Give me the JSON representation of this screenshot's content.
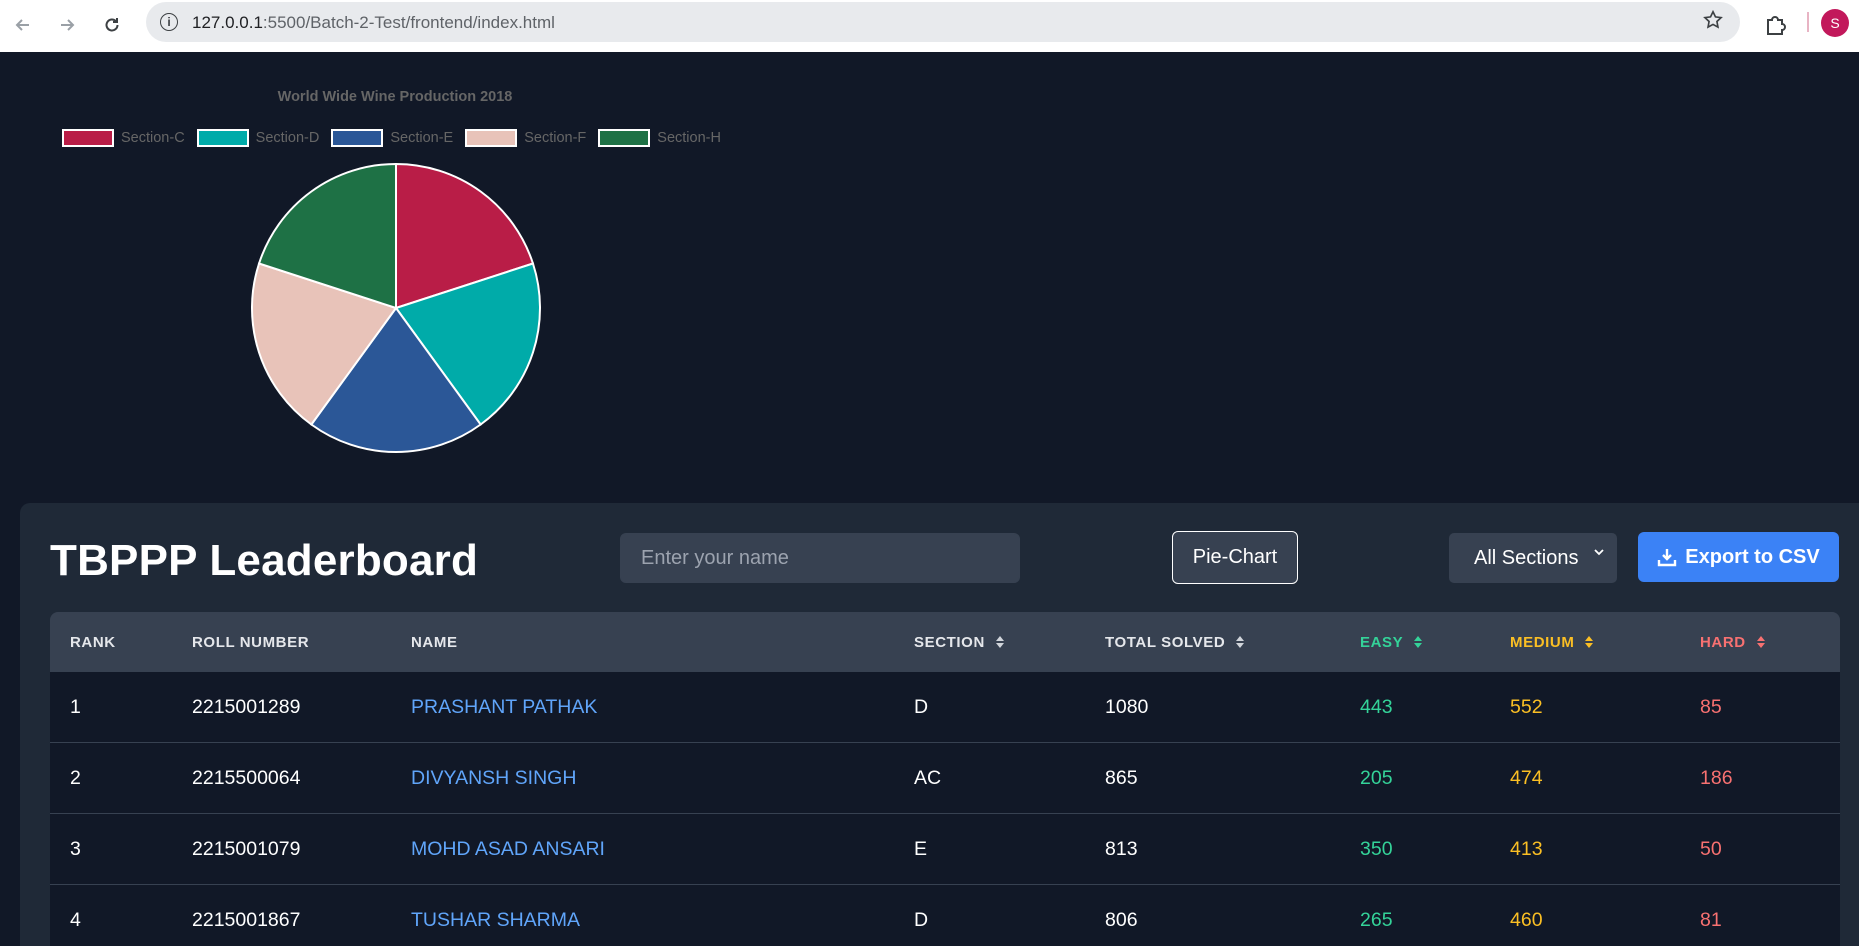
{
  "browser": {
    "url_host": "127.0.0.1",
    "url_path": ":5500/Batch-2-Test/frontend/index.html",
    "profile_initial": "S"
  },
  "chart": {
    "title": "World Wide Wine Production 2018"
  },
  "chart_data": {
    "type": "pie",
    "title": "World Wide Wine Production 2018",
    "categories": [
      "Section-C",
      "Section-D",
      "Section-E",
      "Section-F",
      "Section-H"
    ],
    "values": [
      1,
      1,
      1,
      1,
      1
    ],
    "colors": [
      "#b91d47",
      "#00aba9",
      "#2b5797",
      "#e8c3b9",
      "#1e7145"
    ],
    "legend_position": "top"
  },
  "leaderboard": {
    "title": "TBPPP Leaderboard",
    "search_placeholder": "Enter your name",
    "pie_button": "Pie-Chart",
    "section_selected": "All Sections",
    "export_label": "Export to CSV",
    "columns": [
      "RANK",
      "ROLL NUMBER",
      "NAME",
      "SECTION",
      "TOTAL SOLVED",
      "EASY",
      "MEDIUM",
      "HARD"
    ],
    "column_colors": {
      "easy": "#34d399",
      "medium": "#fbbf24",
      "hard": "#f87171"
    },
    "rows": [
      {
        "rank": "1",
        "roll": "2215001289",
        "name": "PRASHANT PATHAK",
        "section": "D",
        "total": "1080",
        "easy": "443",
        "medium": "552",
        "hard": "85"
      },
      {
        "rank": "2",
        "roll": "2215500064",
        "name": "DIVYANSH SINGH",
        "section": "AC",
        "total": "865",
        "easy": "205",
        "medium": "474",
        "hard": "186"
      },
      {
        "rank": "3",
        "roll": "2215001079",
        "name": "MOHD ASAD ANSARI",
        "section": "E",
        "total": "813",
        "easy": "350",
        "medium": "413",
        "hard": "50"
      },
      {
        "rank": "4",
        "roll": "2215001867",
        "name": "TUSHAR SHARMA",
        "section": "D",
        "total": "806",
        "easy": "265",
        "medium": "460",
        "hard": "81"
      }
    ]
  }
}
